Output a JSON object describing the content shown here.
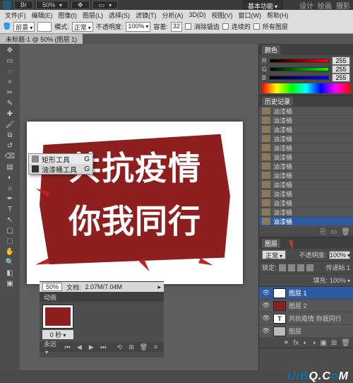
{
  "titlebar": {
    "br_label": "Br",
    "zoom_dd": "50%",
    "hand_icon": "✥",
    "view_icon": "▭",
    "essentials": "基本功能",
    "right": [
      "设计",
      "绘画",
      "摄影"
    ]
  },
  "menu": [
    "文件(F)",
    "编辑(E)",
    "图像(I)",
    "图层(L)",
    "选择(S)",
    "滤镜(T)",
    "分析(A)",
    "3D(D)",
    "视图(V)",
    "窗口(W)",
    "帮助(H)"
  ],
  "options": {
    "fg_label": "前景",
    "mode_label": "模式:",
    "mode_value": "正常",
    "opacity_label": "不透明度:",
    "opacity_value": "100%",
    "tolerance_label": "容差:",
    "tolerance_value": "32",
    "aa": "消除锯齿",
    "contiguous": "连续的",
    "all_layers": "所有图层"
  },
  "doc_tab": "未标题-1 @ 50% (图层 1)",
  "canvas_text": {
    "line1": "共抗疫情",
    "line2": "你我同行"
  },
  "flyout": {
    "items": [
      {
        "label": "矩形工具",
        "key": "G"
      },
      {
        "label": "油漆桶工具",
        "key": "G"
      }
    ]
  },
  "color_panel": {
    "tab": "颜色",
    "r": 255,
    "g": 255,
    "b": 255
  },
  "history_panel": {
    "tab": "历史记录",
    "items": [
      "油漆桶",
      "油漆桶",
      "油漆桶",
      "油漆桶",
      "油漆桶",
      "油漆桶",
      "油漆桶",
      "油漆桶",
      "油漆桶",
      "油漆桶",
      "油漆桶",
      "油漆桶",
      "油漆桶"
    ],
    "selected_index": 12
  },
  "layers_panel": {
    "tab": "图层",
    "blend": "正常",
    "opacity_label": "不透明度:",
    "opacity": "100%",
    "lock_label": "锁定:",
    "fill_label": "填充:",
    "fill": "100%",
    "passthrough": "传递帖 1",
    "layers": [
      {
        "name": "图层 1",
        "selected": true,
        "thumb": "white"
      },
      {
        "name": "图层 2",
        "thumb": "red"
      },
      {
        "name": "共抗疫情 你我同行",
        "type": "T"
      },
      {
        "name": "图层",
        "thumb": "gray"
      }
    ]
  },
  "status": {
    "zoom": "50%",
    "docsize_label": "文档:",
    "docsize": "2.07M/7.04M"
  },
  "animation": {
    "tab": "动画",
    "frame_time": "0 秒",
    "loop": "永远"
  },
  "watermark": {
    "a": "UiB",
    "b": "Q.C",
    "c": "o",
    "d": "M"
  }
}
